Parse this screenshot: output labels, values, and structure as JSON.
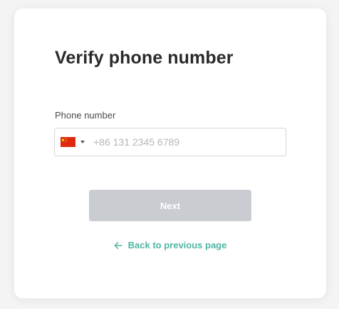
{
  "page": {
    "title": "Verify phone number"
  },
  "phone": {
    "label": "Phone number",
    "country": "CN",
    "flag_icon": "china-flag-icon",
    "placeholder": "+86 131 2345 6789",
    "value": ""
  },
  "actions": {
    "next_label": "Next",
    "next_enabled": false,
    "back_label": "Back to previous page",
    "back_icon": "arrow-left-icon"
  },
  "colors": {
    "accent": "#4db6a4",
    "button_disabled": "#c9ccd0",
    "title": "#2b2b2b"
  }
}
